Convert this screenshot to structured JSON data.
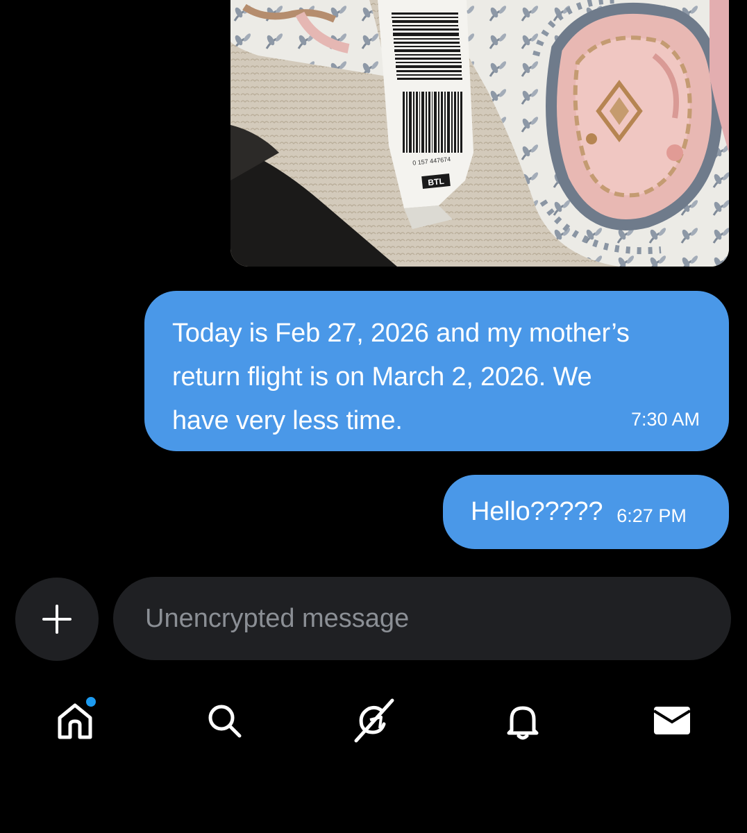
{
  "conversation": {
    "messages": [
      {
        "text": "Today is Feb 27, 2026 and my mother’s\nreturn flight is on March 2, 2026. We\nhave very less time.",
        "time": "7:30 AM"
      },
      {
        "text": "Hello?????",
        "time": "6:27 PM"
      }
    ],
    "attachment": {
      "tag_number": "0 157 447674",
      "tag_label": "BTL"
    }
  },
  "composer": {
    "placeholder": "Unencrypted message",
    "add_icon": "plus-icon"
  },
  "nav": {
    "items": [
      {
        "icon": "home-icon",
        "has_notification_dot": true
      },
      {
        "icon": "search-icon"
      },
      {
        "icon": "grok-icon"
      },
      {
        "icon": "bell-icon"
      },
      {
        "icon": "mail-icon"
      }
    ]
  },
  "colors": {
    "background": "#000000",
    "bubble": "#4a98e8",
    "composer": "#1f2023",
    "placeholder": "#8b8f95",
    "notification_dot": "#1d9bf0"
  }
}
